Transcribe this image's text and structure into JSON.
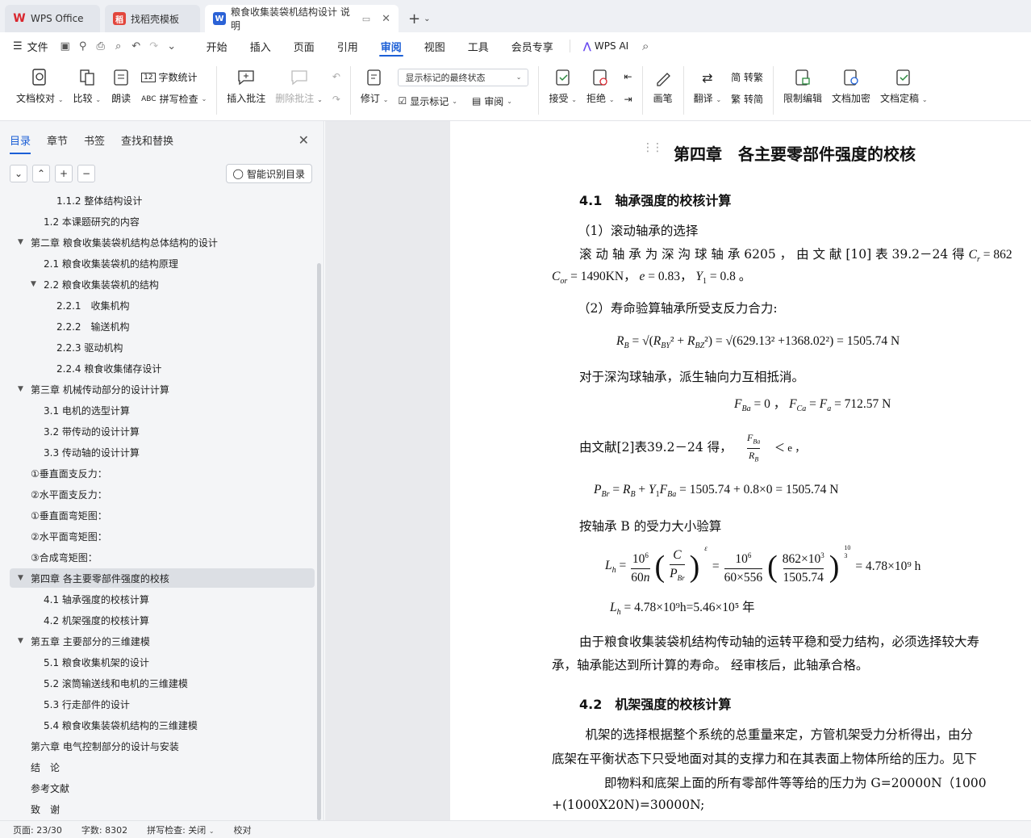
{
  "tabs": [
    {
      "label": "WPS Office"
    },
    {
      "label": "找稻壳模板"
    },
    {
      "label": "粮食收集装袋机结构设计 说明"
    }
  ],
  "menu": {
    "file": "文件",
    "items": [
      "开始",
      "插入",
      "页面",
      "引用",
      "审阅",
      "视图",
      "工具",
      "会员专享"
    ],
    "ai": "WPS AI"
  },
  "ribbon": {
    "doc_check": "文档校对",
    "compare": "比较",
    "read_aloud": "朗读",
    "word_count": "字数统计",
    "spell_check": "拼写检查",
    "insert_comment": "插入批注",
    "delete_comment": "删除批注",
    "revise": "修订",
    "markup_state": "显示标记的最终状态",
    "show_markup": "显示标记",
    "review": "审阅",
    "accept": "接受",
    "reject": "拒绝",
    "pen": "画笔",
    "translate": "翻译",
    "to_trad": "简 转繁",
    "to_simp": "繁 转简",
    "restrict_edit": "限制编辑",
    "encrypt": "文档加密",
    "finalize": "文档定稿"
  },
  "sidebar": {
    "tabs": [
      "目录",
      "章节",
      "书签",
      "查找和替换"
    ],
    "smart_toc": "智能识别目录",
    "toc": [
      {
        "label": "1.1.2 整体结构设计",
        "level": 2
      },
      {
        "label": "1.2 本课题研究的内容",
        "level": 1
      },
      {
        "label": "第二章 粮食收集装袋机结构总体结构的设计",
        "level": 0,
        "expanded": true
      },
      {
        "label": "2.1 粮食收集装袋机的结构原理",
        "level": 1
      },
      {
        "label": "2.2 粮食收集装袋机的结构",
        "level": 1,
        "expanded": true
      },
      {
        "label": "2.2.1　收集机构",
        "level": 2
      },
      {
        "label": "2.2.2　输送机构",
        "level": 2
      },
      {
        "label": "2.2.3 驱动机构",
        "level": 2
      },
      {
        "label": "2.2.4 粮食收集储存设计",
        "level": 2
      },
      {
        "label": "第三章 机械传动部分的设计计算",
        "level": 0,
        "expanded": true
      },
      {
        "label": "3.1 电机的选型计算",
        "level": 1
      },
      {
        "label": "3.2 带传动的设计计算",
        "level": 1
      },
      {
        "label": "3.3 传动轴的设计计算",
        "level": 1
      },
      {
        "label": "①垂直面支反力：",
        "level": 0
      },
      {
        "label": "②水平面支反力：",
        "level": 0
      },
      {
        "label": "①垂直面弯矩图：",
        "level": 0
      },
      {
        "label": "②水平面弯矩图：",
        "level": 0
      },
      {
        "label": "③合成弯矩图：",
        "level": 0
      },
      {
        "label": "第四章 各主要零部件强度的校核",
        "level": 0,
        "expanded": true,
        "selected": true
      },
      {
        "label": "4.1 轴承强度的校核计算",
        "level": 1
      },
      {
        "label": "4.2 机架强度的校核计算",
        "level": 1
      },
      {
        "label": "第五章 主要部分的三维建模",
        "level": 0,
        "expanded": true
      },
      {
        "label": "5.1 粮食收集机架的设计",
        "level": 1
      },
      {
        "label": "5.2 滚筒输送线和电机的三维建模",
        "level": 1
      },
      {
        "label": "5.3 行走部件的设计",
        "level": 1
      },
      {
        "label": "5.4 粮食收集装袋机结构的三维建模",
        "level": 1
      },
      {
        "label": "第六章 电气控制部分的设计与安装",
        "level": 0
      },
      {
        "label": "结　论",
        "level": 0
      },
      {
        "label": "参考文献",
        "level": 0
      },
      {
        "label": "致　谢",
        "level": 0
      }
    ]
  },
  "document": {
    "chapter_title": "第四章　各主要零部件强度的校核",
    "sec41_title": "4.1　轴承强度的校核计算",
    "p1": "（1）滚动轴承的选择",
    "p2a": "滚 动 轴 承 为 深 沟 球 轴 承  6205 ， 由 文 献 [10] 表 39.2－24  得",
    "p2b": "= 862",
    "p3b": "= 1490KN，",
    "p3c": "= 0.83，",
    "p3d": "= 0.8 。",
    "p4": "（2）寿命验算轴承所受支反力合力:",
    "eq1_rhs": "= 1505.74 N",
    "eq1_vals": "629.13² +1368.02²",
    "p5": "对于深沟球轴承，派生轴向力互相抵消。",
    "eq2": "= 0 ，",
    "eq2b": "= 712.57 N",
    "p6": "由文献[2]表39.2－24 得，",
    "p6b": "＜ e ，",
    "eq3_rhs": "= 1505.74 + 0.8×0 = 1505.74 N",
    "p7": "按轴承 B 的受力大小验算",
    "eq4_rhs": "= 4.78×10⁹ h",
    "eq5": "= 4.78×10⁹h=5.46×10⁵ 年",
    "p8": "由于粮食收集装袋机结构传动轴的运转平稳和受力结构，必须选择较大寿",
    "p9": "承，轴承能达到所计算的寿命。 经审核后，此轴承合格。",
    "sec42_title": "4.2　机架强度的校核计算",
    "p10": "　机架的选择根据整个系统的总重量来定，方管机架受力分析得出，由分",
    "p11": "底架在平衡状态下只受地面对其的支撑力和在其表面上物体所给的压力。见下",
    "p12": "　　即物料和底架上面的所有零部件等等给的压力为 G=20000N（1000",
    "p13": "+(1000X20N)=30000N;"
  },
  "status": {
    "page": "页面: 23/30",
    "words": "字数: 8302",
    "spell": "拼写检查: 关闭",
    "proof": "校对"
  },
  "colors": {
    "accent": "#1c5fd6",
    "wps_red": "#d9262e"
  }
}
